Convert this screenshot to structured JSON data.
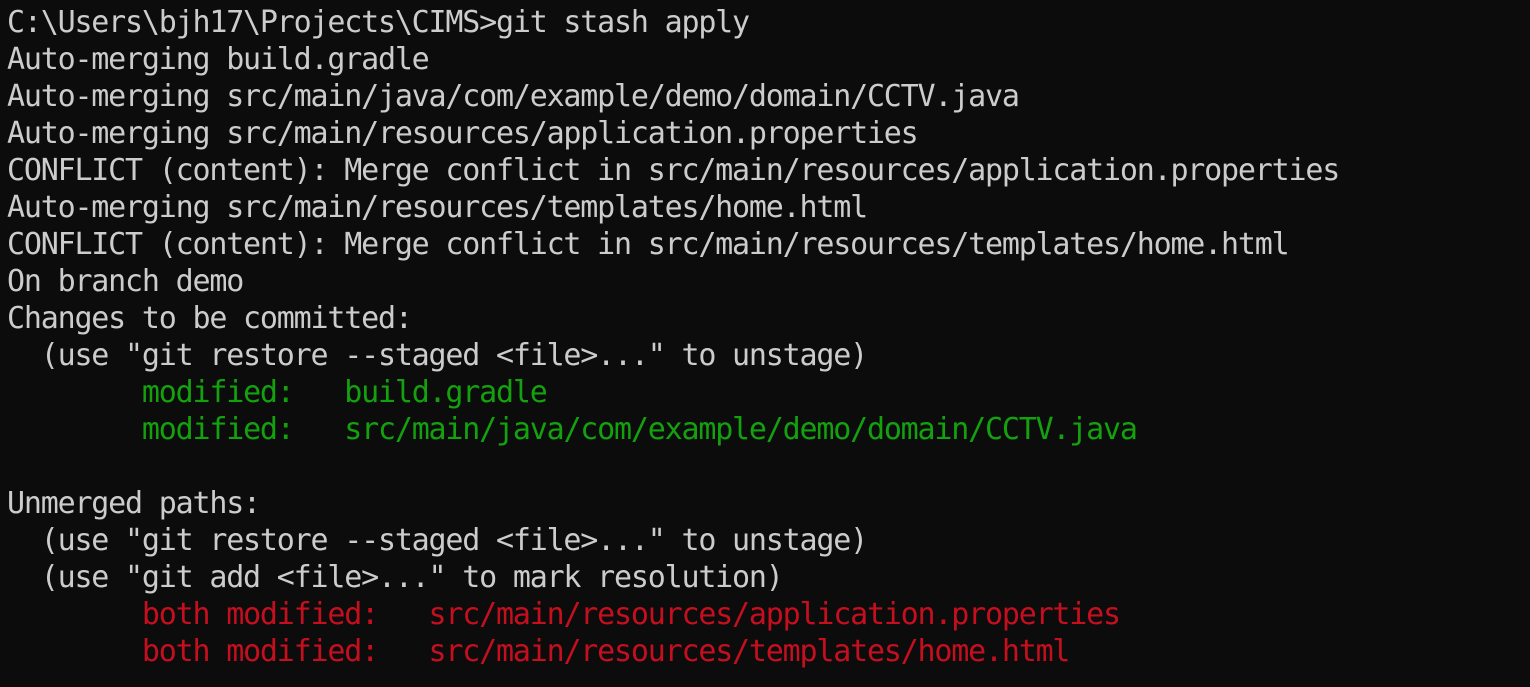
{
  "terminal": {
    "colors": {
      "background": "#0c0c0c",
      "default": "#cccccc",
      "green": "#13a10e",
      "red": "#c50f1f"
    },
    "lines": [
      [
        {
          "text": "C:\\Users\\bjh17\\Projects\\CIMS>git stash apply",
          "color": "default"
        }
      ],
      [
        {
          "text": "Auto-merging build.gradle",
          "color": "default"
        }
      ],
      [
        {
          "text": "Auto-merging src/main/java/com/example/demo/domain/CCTV.java",
          "color": "default"
        }
      ],
      [
        {
          "text": "Auto-merging src/main/resources/application.properties",
          "color": "default"
        }
      ],
      [
        {
          "text": "CONFLICT (content): Merge conflict in src/main/resources/application.properties",
          "color": "default"
        }
      ],
      [
        {
          "text": "Auto-merging src/main/resources/templates/home.html",
          "color": "default"
        }
      ],
      [
        {
          "text": "CONFLICT (content): Merge conflict in src/main/resources/templates/home.html",
          "color": "default"
        }
      ],
      [
        {
          "text": "On branch demo",
          "color": "default"
        }
      ],
      [
        {
          "text": "Changes to be committed:",
          "color": "default"
        }
      ],
      [
        {
          "text": "  (use \"git restore --staged <file>...\" to unstage)",
          "color": "default"
        }
      ],
      [
        {
          "text": "        ",
          "color": "default"
        },
        {
          "text": "modified:   build.gradle",
          "color": "green"
        }
      ],
      [
        {
          "text": "        ",
          "color": "default"
        },
        {
          "text": "modified:   src/main/java/com/example/demo/domain/CCTV.java",
          "color": "green"
        }
      ],
      [
        {
          "text": "",
          "color": "default"
        }
      ],
      [
        {
          "text": "Unmerged paths:",
          "color": "default"
        }
      ],
      [
        {
          "text": "  (use \"git restore --staged <file>...\" to unstage)",
          "color": "default"
        }
      ],
      [
        {
          "text": "  (use \"git add <file>...\" to mark resolution)",
          "color": "default"
        }
      ],
      [
        {
          "text": "        ",
          "color": "default"
        },
        {
          "text": "both modified:   src/main/resources/application.properties",
          "color": "red"
        }
      ],
      [
        {
          "text": "        ",
          "color": "default"
        },
        {
          "text": "both modified:   src/main/resources/templates/home.html",
          "color": "red"
        }
      ]
    ]
  }
}
